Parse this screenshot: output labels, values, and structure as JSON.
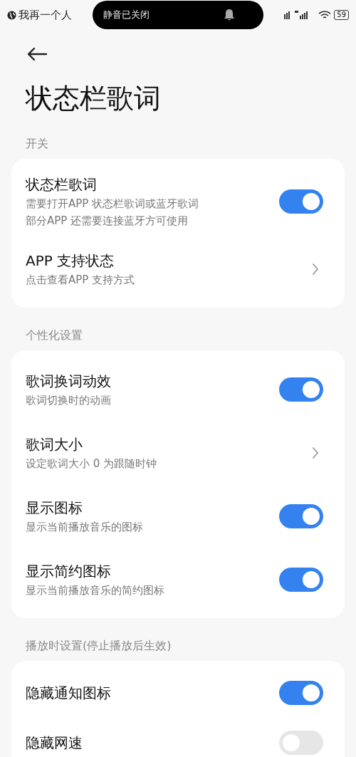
{
  "status_bar": {
    "song": "我再一个人",
    "notice": "静音已关闭",
    "battery": "59"
  },
  "title": "状态栏歌词",
  "sections": [
    {
      "header": "开关",
      "items": [
        {
          "kind": "toggle",
          "title": "状态栏歌词",
          "subtitle": [
            "需要打开APP 状态栏歌词或蓝牙歌词",
            "部分APP 还需要连接蓝牙方可使用"
          ],
          "on": true
        },
        {
          "kind": "link",
          "title": "APP 支持状态",
          "subtitle": [
            "点击查看APP 支持方式"
          ]
        }
      ]
    },
    {
      "header": "个性化设置",
      "items": [
        {
          "kind": "toggle",
          "title": "歌词换词动效",
          "subtitle": [
            "歌词切换时的动画"
          ],
          "on": true
        },
        {
          "kind": "link",
          "title": "歌词大小",
          "subtitle": [
            "设定歌词大小 0 为跟随时钟"
          ]
        },
        {
          "kind": "toggle",
          "title": "显示图标",
          "subtitle": [
            "显示当前播放音乐的图标"
          ],
          "on": true
        },
        {
          "kind": "toggle",
          "title": "显示简约图标",
          "subtitle": [
            "显示当前播放音乐的简约图标"
          ],
          "on": true
        }
      ]
    },
    {
      "header": "播放时设置(停止播放后生效)",
      "items": [
        {
          "kind": "toggle",
          "title": "隐藏通知图标",
          "on": true
        },
        {
          "kind": "toggle",
          "title": "隐藏网速",
          "on": false
        }
      ]
    }
  ]
}
